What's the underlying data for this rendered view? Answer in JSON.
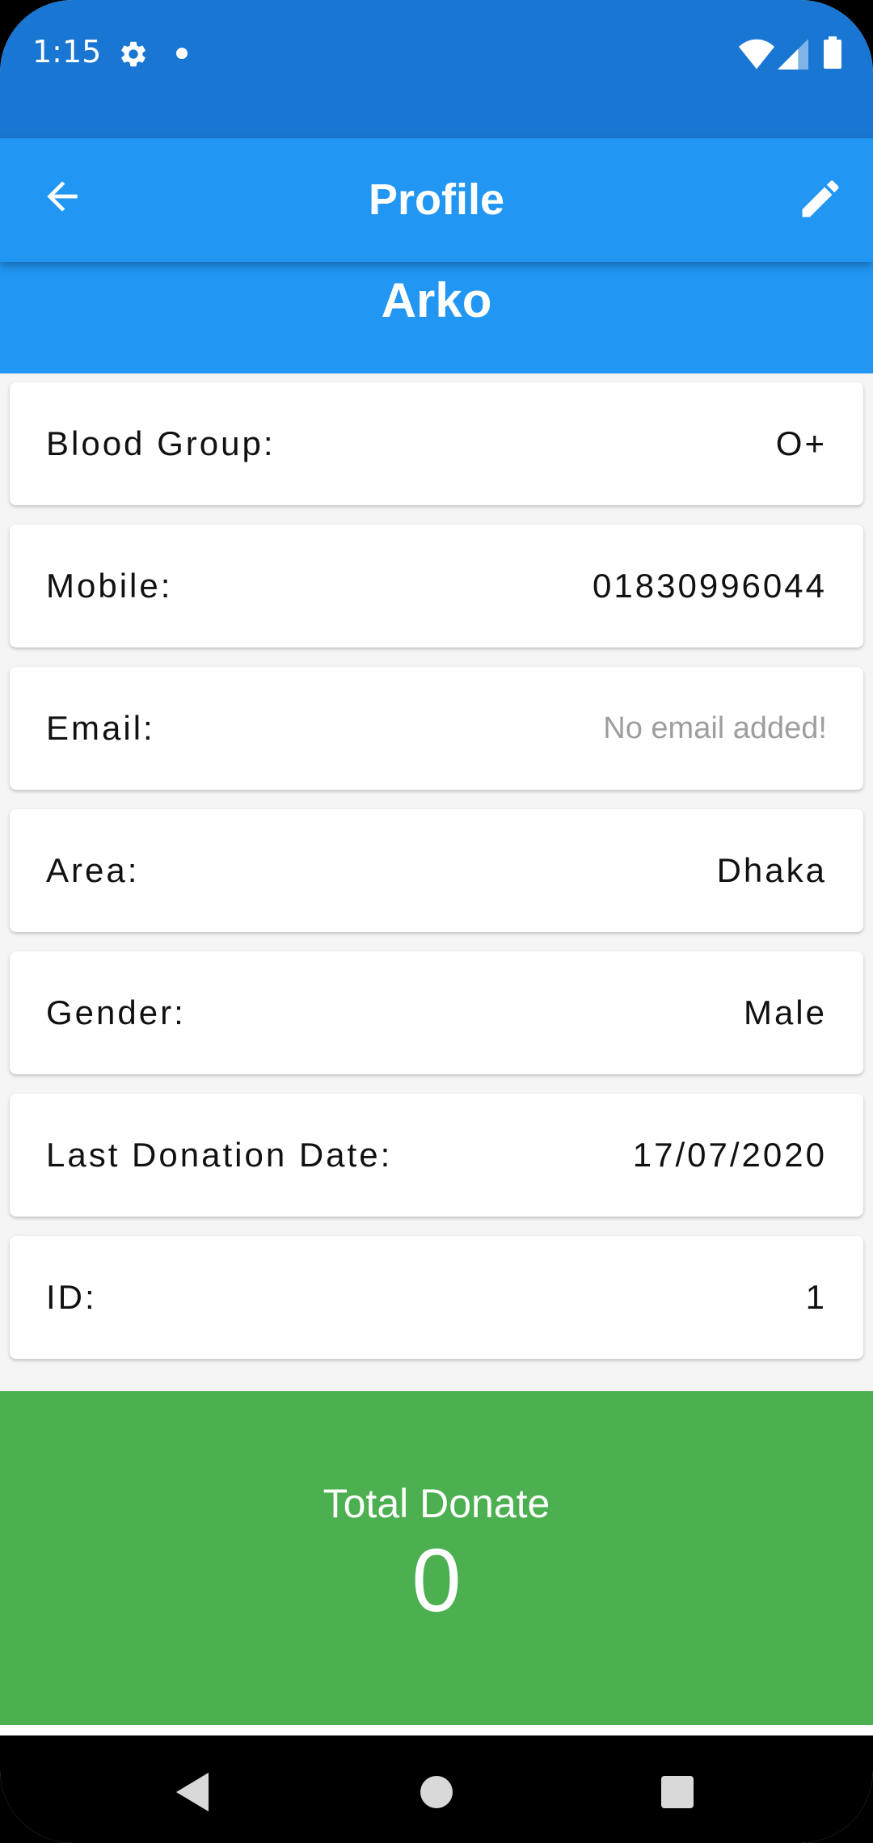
{
  "status_bar": {
    "time": "1:15",
    "icons": [
      "gear-icon",
      "notification-dot-icon",
      "wifi-icon",
      "signal-icon",
      "battery-icon"
    ]
  },
  "app_bar": {
    "title": "Profile",
    "back_icon": "arrow-back-icon",
    "edit_icon": "pencil-icon"
  },
  "profile": {
    "name": "Arko"
  },
  "fields": [
    {
      "label": "Blood Group:",
      "value": "O+"
    },
    {
      "label": "Mobile:",
      "value": "01830996044"
    },
    {
      "label": "Email:",
      "value": "No email added!"
    },
    {
      "label": "Area:",
      "value": "Dhaka"
    },
    {
      "label": "Gender:",
      "value": "Male"
    },
    {
      "label": "Last Donation Date:",
      "value": "17/07/2020"
    },
    {
      "label": "ID:",
      "value": "1"
    }
  ],
  "donate": {
    "label": "Total Donate",
    "count": "0"
  },
  "nav_bar": {
    "icons": [
      "back-triangle-icon",
      "home-circle-icon",
      "recents-square-icon"
    ]
  },
  "colors": {
    "status_bar": "#1976d2",
    "primary": "#2196f3",
    "donate_panel": "#4caf50",
    "background": "#f5f5f5",
    "muted_text": "#9e9e9e"
  }
}
